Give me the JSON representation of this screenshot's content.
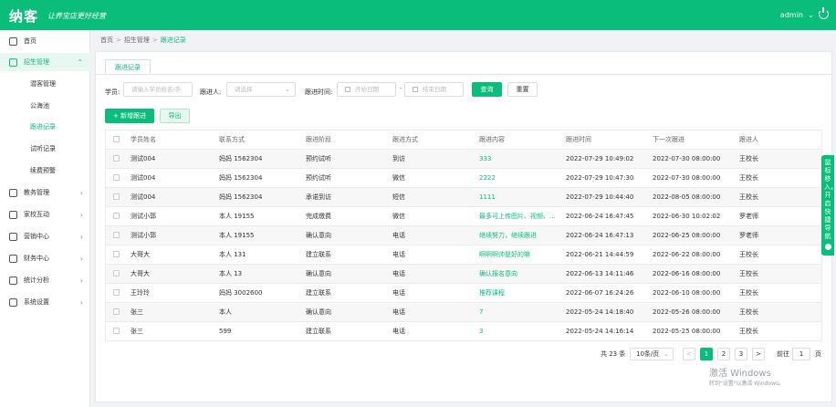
{
  "topbar": {
    "logo": "纳客",
    "slogan": "让养宝店更好经营",
    "user": "admin",
    "user_chevron": "chevron-down-icon",
    "power_icon": "power-icon"
  },
  "sidebar": {
    "items": [
      {
        "label": "首页",
        "icon": "home-icon"
      },
      {
        "label": "招生管理",
        "icon": "user-circle-icon",
        "expanded": true
      },
      {
        "label": "教务管理",
        "icon": "book-icon"
      },
      {
        "label": "家校互动",
        "icon": "chat-icon"
      },
      {
        "label": "营销中心",
        "icon": "megaphone-icon"
      },
      {
        "label": "财务中心",
        "icon": "money-icon"
      },
      {
        "label": "统计分析",
        "icon": "chart-icon"
      },
      {
        "label": "系统设置",
        "icon": "gear-icon"
      }
    ],
    "subitems": [
      "潜客管理",
      "公海池",
      "跟进记录",
      "试听记录",
      "续费预警"
    ],
    "active_sub": "跟进记录"
  },
  "breadcrumb": [
    "首页",
    "招生管理",
    "跟进记录"
  ],
  "tab": "跟进记录",
  "filters": {
    "student_label": "学员:",
    "student_placeholder": "请输入学员姓名/手",
    "follower_label": "跟进人:",
    "follower_placeholder": "请选择",
    "time_label": "跟进时间:",
    "start_placeholder": "开始日期",
    "range_sep": "-",
    "end_placeholder": "结束日期",
    "query": "查询",
    "reset": "重置"
  },
  "actions": {
    "add": "+ 新增跟进",
    "export": "导出"
  },
  "table": {
    "headers": [
      "学员姓名",
      "联系方式",
      "跟进阶段",
      "跟进方式",
      "跟进内容",
      "跟进时间",
      "下一次跟进",
      "跟进人"
    ],
    "rows": [
      [
        "测试004",
        "妈妈 1562304",
        "预约试听",
        "到访",
        "333",
        "2022-07-29 10:49:02",
        "2022-07-30 08:00:00",
        "王校长"
      ],
      [
        "测试004",
        "妈妈 1562304",
        "预约试听",
        "微信",
        "2222",
        "2022-07-29 10:47:30",
        "2022-07-30 08:00:00",
        "王校长"
      ],
      [
        "测试004",
        "妈妈 1562304",
        "承诺到访",
        "短信",
        "1111",
        "2022-07-29 10:44:40",
        "2022-08-05 08:00:00",
        "王校长"
      ],
      [
        "测试小郭",
        "本人 19155",
        "完成缴费",
        "微信",
        "最多可上传图片、视频、...",
        "2022-06-24 16:47:45",
        "2022-06-30 10:02:02",
        "罗老师"
      ],
      [
        "测试小郭",
        "本人 19155",
        "确认意向",
        "电话",
        "继续努力，继续跟进",
        "2022-06-24 16:47:13",
        "2022-06-25 08:00:00",
        "罗老师"
      ],
      [
        "大哥大",
        "本人 131",
        "建立联系",
        "电话",
        "啊啊啊帅是好的嘛",
        "2022-06-21 14:44:59",
        "2022-06-22 08:00:00",
        "王校长"
      ],
      [
        "大哥大",
        "本人 13",
        "确认意向",
        "电话",
        "确认报名意向",
        "2022-06-13 14:11:46",
        "2022-06-16 08:00:00",
        "王校长"
      ],
      [
        "王玲玲",
        "妈妈 3002600",
        "建立联系",
        "电话",
        "推荐课程",
        "2022-06-07 16:24:26",
        "2022-06-10 08:00:00",
        "王校长"
      ],
      [
        "张三",
        "本人",
        "确认意向",
        "电话",
        "7",
        "2022-05-24 14:18:40",
        "2022-05-26 08:00:00",
        "王校长"
      ],
      [
        "张三",
        "599",
        "建立联系",
        "电话",
        "3",
        "2022-05-24 14:16:14",
        "2022-05-25 08:00:00",
        "王校长"
      ]
    ]
  },
  "pagination": {
    "total": "共 23 条",
    "page_size": "10条/页",
    "prev": "<",
    "pages": [
      "1",
      "2",
      "3"
    ],
    "next": ">",
    "goto_label": "前往",
    "goto_value": "1",
    "goto_suffix": "页"
  },
  "side_tab": {
    "text": "鼠标移入，开启快捷导航",
    "icon": "info-icon"
  },
  "watermark": {
    "title": "激活 Windows",
    "sub": "转到\"设置\"以激活 Windows。"
  },
  "colors": {
    "brand": "#0bbd7a"
  }
}
